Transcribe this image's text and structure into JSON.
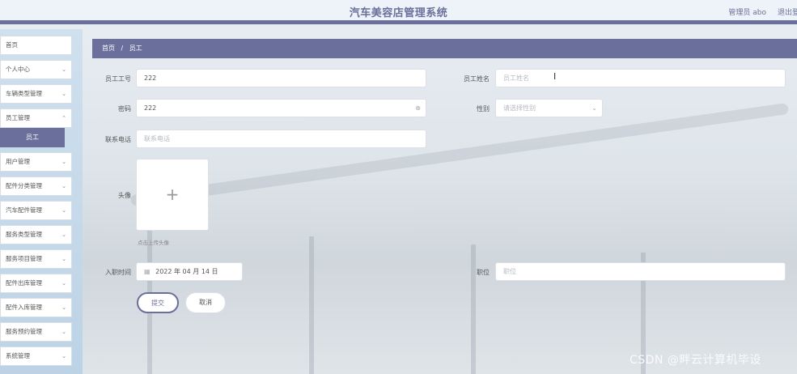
{
  "header": {
    "title": "汽车美容店管理系统",
    "admin": "管理员 abo",
    "logout": "退出登录"
  },
  "sidebar": {
    "items": [
      {
        "label": "首页",
        "chevron": ""
      },
      {
        "label": "个人中心",
        "chevron": "⌄"
      },
      {
        "label": "车辆类型管理",
        "chevron": "⌄"
      },
      {
        "label": "员工管理",
        "chevron": "⌃"
      },
      {
        "label": "用户管理",
        "chevron": "⌄"
      },
      {
        "label": "配件分类管理",
        "chevron": "⌄"
      },
      {
        "label": "汽车配件管理",
        "chevron": "⌄"
      },
      {
        "label": "服务类型管理",
        "chevron": "⌄"
      },
      {
        "label": "服务项目管理",
        "chevron": "⌄"
      },
      {
        "label": "配件出库管理",
        "chevron": "⌄"
      },
      {
        "label": "配件入库管理",
        "chevron": "⌄"
      },
      {
        "label": "服务预约管理",
        "chevron": "⌄"
      },
      {
        "label": "系统管理",
        "chevron": "⌄"
      }
    ],
    "submenu_active": "员工"
  },
  "breadcrumb": {
    "home": "首页",
    "separator": "/",
    "current": "员工"
  },
  "form": {
    "employee_id": {
      "label": "员工工号",
      "value": "222"
    },
    "employee_name": {
      "label": "员工姓名",
      "placeholder": "员工姓名"
    },
    "password": {
      "label": "密码",
      "value": "222",
      "suffix": "⊗"
    },
    "gender": {
      "label": "性别",
      "placeholder": "请选择性别",
      "chevron": "⌄"
    },
    "phone": {
      "label": "联系电话",
      "placeholder": "联系电话"
    },
    "avatar": {
      "label": "头像",
      "plus": "+",
      "hint": "点击上传头像"
    },
    "hire_date": {
      "label": "入职时间",
      "value": "2022 年 04 月 14 日",
      "icon": "▦"
    },
    "position": {
      "label": "职位",
      "placeholder": "职位"
    },
    "text_cursor": "I"
  },
  "buttons": {
    "submit": "提交",
    "cancel": "取消"
  },
  "watermark": "CSDN @畔云计算机毕设",
  "colors": {
    "primary": "#6b6f9b",
    "sidebar_bg": "#c7dbea",
    "header_bg": "#edf3f8"
  }
}
